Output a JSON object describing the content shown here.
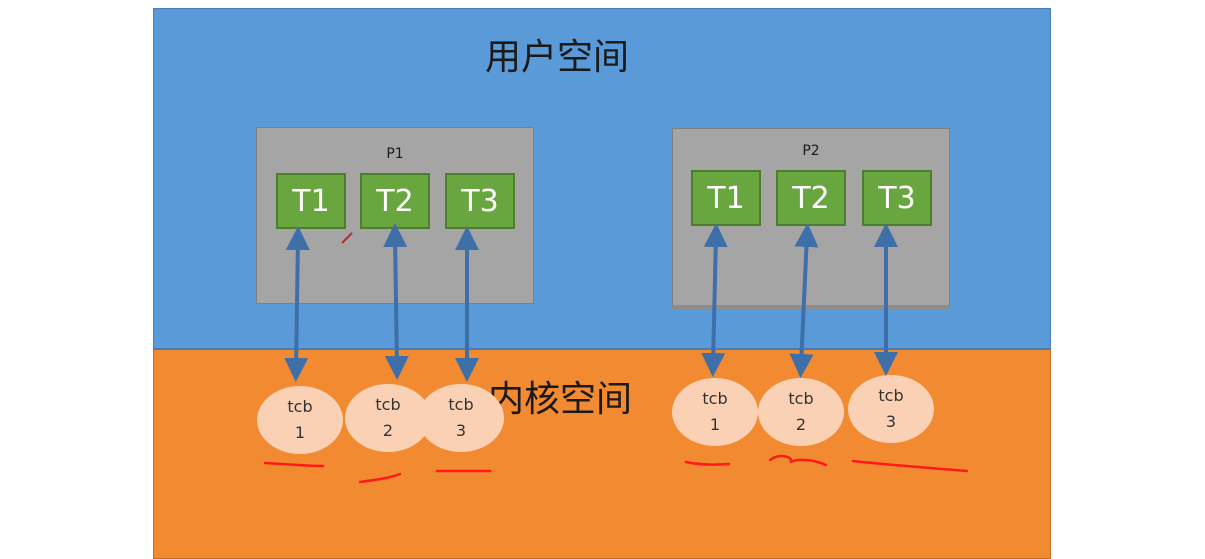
{
  "regions": {
    "user_space": "用户空间",
    "kernel_space": "内核空间"
  },
  "processes": [
    {
      "name": "P1",
      "threads": [
        "T1",
        "T2",
        "T3"
      ],
      "tcbs": [
        {
          "line1": "tcb",
          "line2": "1"
        },
        {
          "line1": "tcb",
          "line2": "2"
        },
        {
          "line1": "tcb",
          "line2": "3"
        }
      ]
    },
    {
      "name": "P2",
      "threads": [
        "T1",
        "T2",
        "T3"
      ],
      "tcbs": [
        {
          "line1": "tcb",
          "line2": "1"
        },
        {
          "line1": "tcb",
          "line2": "2"
        },
        {
          "line1": "tcb",
          "line2": "3"
        }
      ]
    }
  ],
  "colors": {
    "user_space": "#5b9ad9",
    "kernel_space": "#f28a31",
    "process_box": "#a5a5a5",
    "thread_box": "#6aa63f",
    "tcb_bubble": "#fbd1b5",
    "arrow": "#3f6fa8",
    "annotation": "#ff1a1a"
  }
}
